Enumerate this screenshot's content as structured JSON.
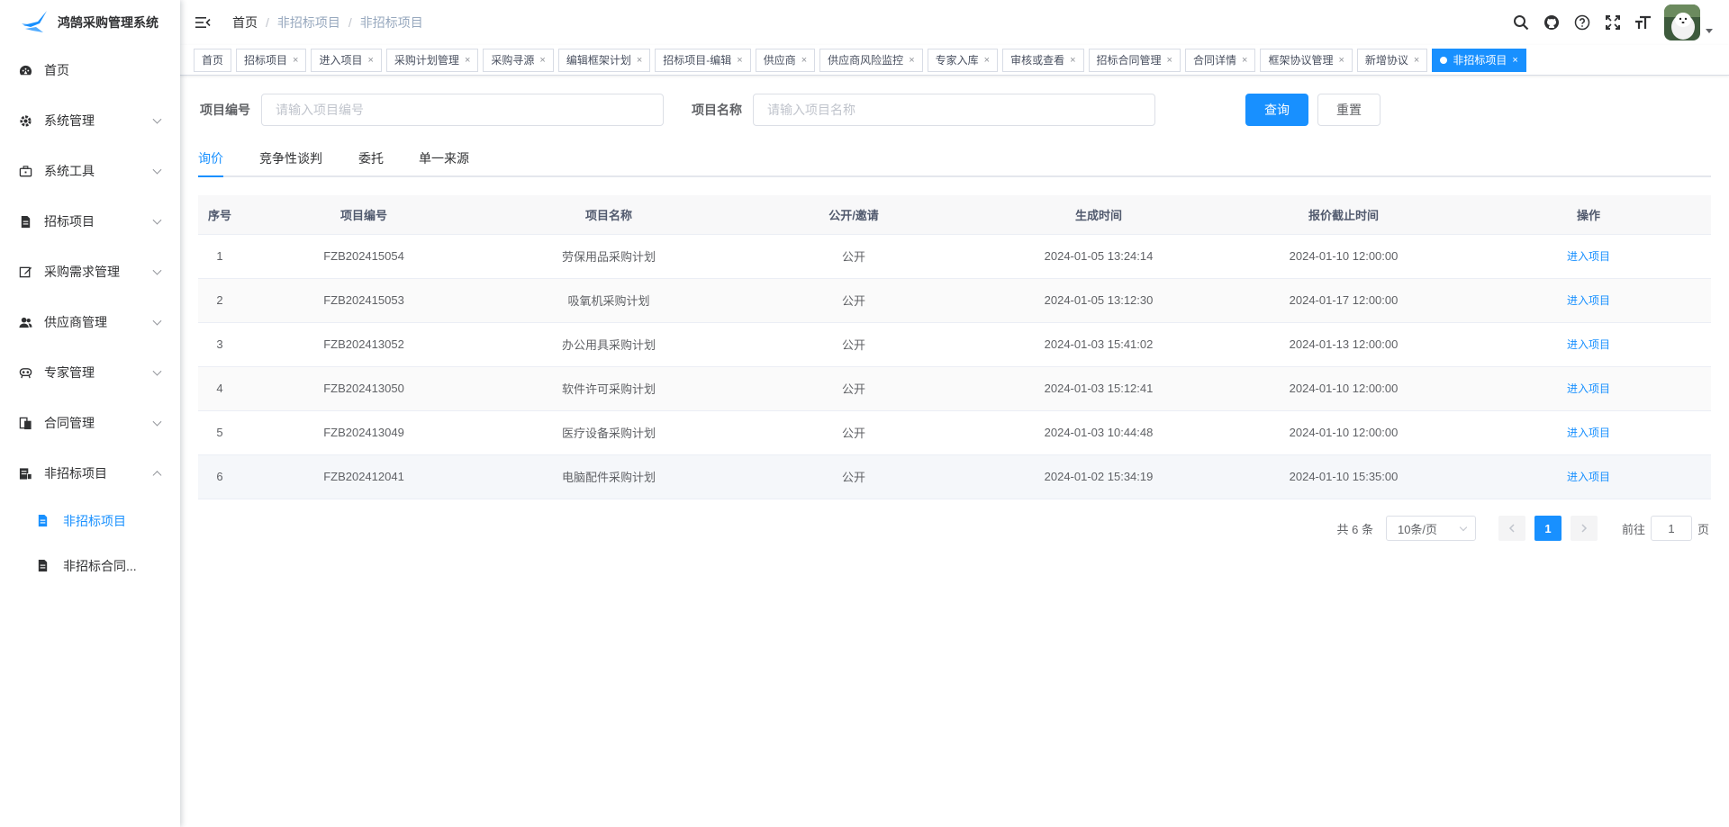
{
  "app": {
    "title": "鸿鹄采购管理系统"
  },
  "sidebar": {
    "items": [
      {
        "label": "首页",
        "icon": "dashboard-icon"
      },
      {
        "label": "系统管理",
        "icon": "gear-icon"
      },
      {
        "label": "系统工具",
        "icon": "toolbox-icon"
      },
      {
        "label": "招标项目",
        "icon": "document-icon"
      },
      {
        "label": "采购需求管理",
        "icon": "edit-icon"
      },
      {
        "label": "供应商管理",
        "icon": "users-icon"
      },
      {
        "label": "专家管理",
        "icon": "expert-icon"
      },
      {
        "label": "合同管理",
        "icon": "contract-icon"
      },
      {
        "label": "非招标项目",
        "icon": "non-bid-icon"
      }
    ],
    "submenu": [
      {
        "label": "非招标项目"
      },
      {
        "label": "非招标合同..."
      }
    ]
  },
  "navbar": {
    "breadcrumb": [
      "首页",
      "非招标项目",
      "非招标项目"
    ]
  },
  "tags": [
    "首页",
    "招标项目",
    "进入项目",
    "采购计划管理",
    "采购寻源",
    "编辑框架计划",
    "招标项目-编辑",
    "供应商",
    "供应商风险监控",
    "专家入库",
    "审核或查看",
    "招标合同管理",
    "合同详情",
    "框架协议管理",
    "新增协议",
    "非招标项目"
  ],
  "search": {
    "code_label": "项目编号",
    "code_placeholder": "请输入项目编号",
    "name_label": "项目名称",
    "name_placeholder": "请输入项目名称",
    "query_label": "查询",
    "reset_label": "重置"
  },
  "tabs": [
    "询价",
    "竞争性谈判",
    "委托",
    "单一来源"
  ],
  "table": {
    "headers": [
      "序号",
      "项目编号",
      "项目名称",
      "公开/邀请",
      "生成时间",
      "报价截止时间",
      "操作"
    ],
    "rows": [
      {
        "no": "1",
        "code": "FZB202415054",
        "name": "劳保用品采购计划",
        "type": "公开",
        "created": "2024-01-05 13:24:14",
        "deadline": "2024-01-10 12:00:00",
        "action": "进入项目"
      },
      {
        "no": "2",
        "code": "FZB202415053",
        "name": "吸氧机采购计划",
        "type": "公开",
        "created": "2024-01-05 13:12:30",
        "deadline": "2024-01-17 12:00:00",
        "action": "进入项目"
      },
      {
        "no": "3",
        "code": "FZB202413052",
        "name": "办公用具采购计划",
        "type": "公开",
        "created": "2024-01-03 15:41:02",
        "deadline": "2024-01-13 12:00:00",
        "action": "进入项目"
      },
      {
        "no": "4",
        "code": "FZB202413050",
        "name": "软件许可采购计划",
        "type": "公开",
        "created": "2024-01-03 15:12:41",
        "deadline": "2024-01-10 12:00:00",
        "action": "进入项目"
      },
      {
        "no": "5",
        "code": "FZB202413049",
        "name": "医疗设备采购计划",
        "type": "公开",
        "created": "2024-01-03 10:44:48",
        "deadline": "2024-01-10 12:00:00",
        "action": "进入项目"
      },
      {
        "no": "6",
        "code": "FZB202412041",
        "name": "电脑配件采购计划",
        "type": "公开",
        "created": "2024-01-02 15:34:19",
        "deadline": "2024-01-10 15:35:00",
        "action": "进入项目"
      }
    ]
  },
  "pagination": {
    "total": "共 6 条",
    "page_size": "10条/页",
    "current_page": "1",
    "goto_label": "前往",
    "goto_value": "1",
    "page_suffix": "页"
  },
  "colors": {
    "accent": "#1890ff"
  }
}
